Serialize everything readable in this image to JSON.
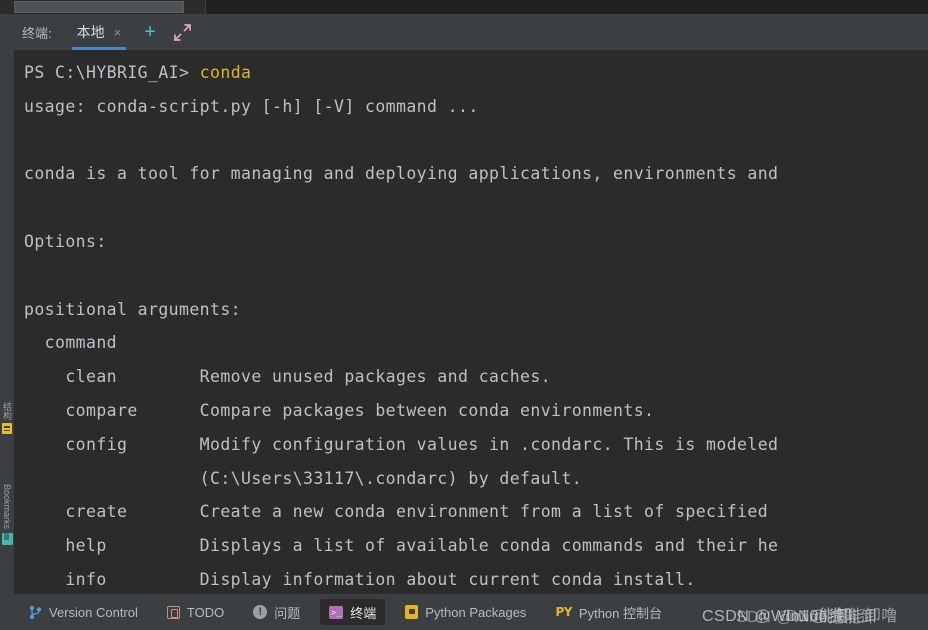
{
  "window": {
    "theme_bg": "#2b2b2b",
    "panel_bg": "#3c3f41",
    "accent_blue": "#4a88c7"
  },
  "terminal_header": {
    "label": "终端:",
    "tab_name": "本地",
    "close_glyph": "×",
    "add_glyph": "+",
    "add_icon_name": "plus-icon",
    "expand_icon_name": "expand-icon",
    "accent_add_color": "#4bbcc4",
    "accent_expand_color": "#e7a4b6"
  },
  "terminal": {
    "lines": [
      {
        "segments": [
          {
            "text": "PS C:\\HYBRIG_AI> ",
            "style": "plain"
          },
          {
            "text": "conda",
            "style": "cmd"
          }
        ]
      },
      {
        "segments": [
          {
            "text": "usage: conda-script.py [-h] [-V] command ...",
            "style": "plain"
          }
        ]
      },
      {
        "segments": [
          {
            "text": "",
            "style": "plain"
          }
        ]
      },
      {
        "segments": [
          {
            "text": "conda is a tool for managing and deploying applications, environments and",
            "style": "plain"
          }
        ]
      },
      {
        "segments": [
          {
            "text": "",
            "style": "plain"
          }
        ]
      },
      {
        "segments": [
          {
            "text": "Options:",
            "style": "plain"
          }
        ]
      },
      {
        "segments": [
          {
            "text": "",
            "style": "plain"
          }
        ]
      },
      {
        "segments": [
          {
            "text": "positional arguments:",
            "style": "plain"
          }
        ]
      },
      {
        "segments": [
          {
            "text": "  command",
            "style": "plain"
          }
        ]
      },
      {
        "segments": [
          {
            "text": "    clean        Remove unused packages and caches.",
            "style": "plain"
          }
        ]
      },
      {
        "segments": [
          {
            "text": "    compare      Compare packages between conda environments.",
            "style": "plain"
          }
        ]
      },
      {
        "segments": [
          {
            "text": "    config       Modify configuration values in .condarc. This is modeled",
            "style": "plain"
          }
        ]
      },
      {
        "segments": [
          {
            "text": "                 (C:\\Users\\33117\\.condarc) by default.",
            "style": "plain"
          }
        ]
      },
      {
        "segments": [
          {
            "text": "    create       Create a new conda environment from a list of specified",
            "style": "plain"
          }
        ]
      },
      {
        "segments": [
          {
            "text": "    help         Displays a list of available conda commands and their he",
            "style": "plain"
          }
        ]
      },
      {
        "segments": [
          {
            "text": "    info         Display information about current conda install.",
            "style": "plain"
          }
        ]
      }
    ]
  },
  "left_rail": {
    "items": [
      {
        "label": "结构",
        "icon": "structure-icon"
      },
      {
        "label": "Bookmarks",
        "icon": "bookmarks-icon"
      }
    ]
  },
  "statusbar": {
    "items": [
      {
        "label": "Version Control",
        "icon": "branch-icon",
        "active": false
      },
      {
        "label": "TODO",
        "icon": "todo-icon",
        "active": false
      },
      {
        "label": "问题",
        "icon": "problem-icon",
        "active": false
      },
      {
        "label": "终端",
        "icon": "terminal-icon",
        "active": true
      },
      {
        "label": "Python Packages",
        "icon": "python-packages-icon",
        "active": false
      },
      {
        "label": "Python 控制台",
        "icon": "python-console-icon",
        "active": false
      }
    ],
    "problem_glyph": "!",
    "terminal_glyph": ">_",
    "python_console_glyph": "PY"
  },
  "watermark": {
    "line_a": "CSDN @Win10能卸",
    "line_b": "SDN @win0抱能卸",
    "line_c": "DN@ 抱能卸噜"
  }
}
